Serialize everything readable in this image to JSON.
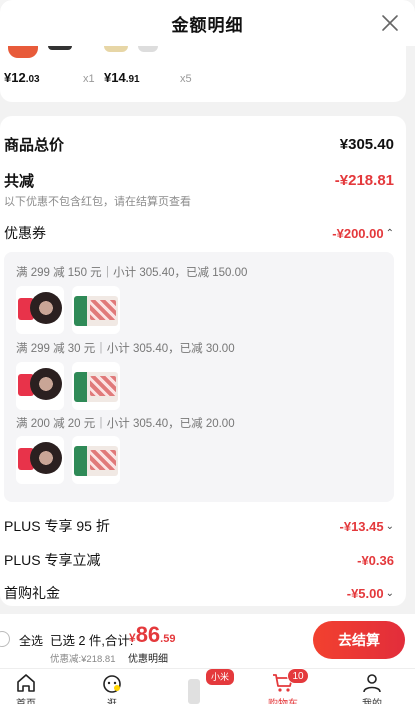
{
  "header": {
    "title": "金额明细"
  },
  "products": [
    {
      "price_int": "¥12",
      "price_dec": ".03",
      "qty": "x1"
    },
    {
      "price_int": "¥14",
      "price_dec": ".91",
      "qty": "x5"
    }
  ],
  "summary": {
    "goods_total_label": "商品总价",
    "goods_total_value": "¥305.40",
    "total_discount_label": "共减",
    "total_discount_value": "-¥218.81",
    "note": "以下优惠不包含红包，请在结算页查看",
    "coupon_label": "优惠券",
    "coupon_value": "-¥200.00",
    "coupons": [
      {
        "text": "满 299 减 150 元｜小计 305.40，已减 150.00"
      },
      {
        "text": "满 299 减 30 元｜小计 305.40，已减 30.00"
      },
      {
        "text": "满 200 减 20 元｜小计 305.40，已减 20.00"
      }
    ],
    "plus95_label": "PLUS 专享 95 折",
    "plus95_value": "-¥13.45",
    "plus_cut_label": "PLUS 专享立减",
    "plus_cut_value": "-¥0.36",
    "first_gift_label": "首购礼金",
    "first_gift_value": "-¥5.00"
  },
  "bottom": {
    "select_all": "全选",
    "selected_info": "已选 2 件,合计:",
    "currency": "¥",
    "total_int": "86",
    "total_dec": ".59",
    "discount_line": "优惠减:¥218.81",
    "detail_link": "优惠明细",
    "checkout": "去结算"
  },
  "tabs": [
    {
      "label": "首页"
    },
    {
      "label": "逛"
    },
    {
      "label": "购物车",
      "badge": "10"
    },
    {
      "label": "我的"
    }
  ],
  "promo_tag": "小米",
  "colors": {
    "accent": "#e4393c",
    "background": "#f2f2f2"
  }
}
